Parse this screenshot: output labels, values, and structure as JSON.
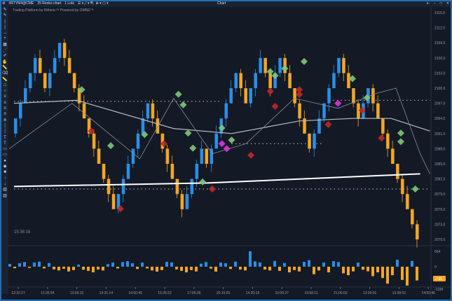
{
  "window": {
    "symbol": "#RTYM4@CME",
    "chart_type": "25 Renko chart",
    "lots": "1 Lots",
    "title": "Chart",
    "subtitle": "Trading Platform by Rithmic™  Powered by OMNE™",
    "win_controls": [
      "⇤",
      "–",
      "□",
      "✕"
    ]
  },
  "toolbar_icons": [
    "pencil",
    "pencil",
    "line",
    "line",
    "arrow",
    "plus",
    "grid",
    "dots",
    "brush",
    "hand",
    "ruler",
    "eraser",
    "ruler",
    "rect",
    "ellipse",
    "fib",
    "fib",
    "fib",
    "fib",
    "pitchfork",
    "dash",
    "dash",
    "text",
    "T",
    "shape",
    "shape",
    "circle",
    "diamond",
    "square",
    "up",
    "down",
    "bars",
    "bars"
  ],
  "clock": "15:36:16",
  "price_axis": {
    "labels": [
      "2115.0",
      "2112.0",
      "2109.0",
      "2106.0",
      "2103.0",
      "2100.0",
      "2097.0",
      "2094.0",
      "2091.0",
      "2088.0",
      "2085.0",
      "2082.0",
      "2079.0",
      "2076.0",
      "2073.0",
      "2070.0"
    ]
  },
  "volume_axis": {
    "labels": [
      "664",
      "0",
      "-1189"
    ],
    "last_label": "-731"
  },
  "time_axis": [
    "13:32:27",
    "13:35:54",
    "13:56:10",
    "14:31:14",
    "14:50:45",
    "15:26:22",
    "17:05:26",
    "20:16:03",
    "14:30:18",
    "15:09:27",
    "19:58:11",
    "21:00:00",
    "13:30:01",
    "13:58:02",
    "14:50:46"
  ],
  "colors": {
    "up": "#2b8ee6",
    "down": "#f5a623",
    "green": "#6fbf6a",
    "red": "#c0282b",
    "magenta": "#e033e0",
    "bg": "#131a26"
  },
  "chart_data": {
    "type": "renko",
    "brick": 3,
    "waypoints": [
      2089.7,
      2105.7,
      2099.4,
      2107.8,
      2076.5,
      2098,
      2077,
      2088,
      2084,
      2104.3,
      2097,
      2105,
      2100,
      2106,
      2089,
      2106,
      2093,
      2101,
      2069
    ],
    "ylim": [
      2068,
      2116
    ],
    "ma_slow": [
      [
        0,
        2080.5
      ],
      [
        40,
        2081.2
      ],
      [
        84,
        2083
      ]
    ],
    "ma_mid": [
      [
        0,
        2097
      ],
      [
        13,
        2097.6
      ],
      [
        33,
        2092
      ],
      [
        45,
        2091
      ],
      [
        59,
        2093.5
      ],
      [
        70,
        2094
      ],
      [
        78,
        2094
      ],
      [
        86,
        2091.5
      ]
    ],
    "ma_fast": [
      [
        -1,
        2088
      ],
      [
        12,
        2097
      ],
      [
        26,
        2086
      ],
      [
        33,
        2098
      ],
      [
        41,
        2087
      ],
      [
        48,
        2089
      ],
      [
        58,
        2098
      ],
      [
        67,
        2096
      ],
      [
        75,
        2099
      ],
      [
        79,
        2100
      ],
      [
        84,
        2087
      ],
      [
        86,
        2083
      ]
    ],
    "levels": [
      [
        0,
        43,
        2097.4
      ],
      [
        45,
        64,
        2089
      ],
      [
        66,
        86,
        2097.6
      ],
      [
        0,
        86,
        2080
      ]
    ],
    "markers": [
      [
        14,
        2099.7,
        "green"
      ],
      [
        20,
        2088.6,
        "green"
      ],
      [
        27,
        2090.8,
        "green"
      ],
      [
        34,
        2098.8,
        "green"
      ],
      [
        35,
        2096.7,
        "green"
      ],
      [
        36,
        2091.1,
        "green"
      ],
      [
        37,
        2088.1,
        "green"
      ],
      [
        39,
        2081.4,
        "green"
      ],
      [
        43,
        2092.1,
        "green"
      ],
      [
        45,
        2089.7,
        "green"
      ],
      [
        53,
        2103.3,
        "green"
      ],
      [
        54,
        2102.5,
        "green"
      ],
      [
        56,
        2103.9,
        "green"
      ],
      [
        60,
        2105.3,
        "green"
      ],
      [
        70,
        2101.9,
        "green"
      ],
      [
        73,
        2098.1,
        "green"
      ],
      [
        80,
        2091.1,
        "green"
      ],
      [
        80,
        2089.4,
        "green"
      ],
      [
        83,
        2080,
        "green"
      ],
      [
        16,
        2091.5,
        "red"
      ],
      [
        31,
        2089,
        "red"
      ],
      [
        41,
        2080,
        "red"
      ],
      [
        22,
        2076.1,
        "red"
      ],
      [
        49,
        2086.7,
        "red"
      ],
      [
        53,
        2099.4,
        "red"
      ],
      [
        54,
        2096.4,
        "red"
      ],
      [
        59,
        2099.7,
        "red"
      ],
      [
        59,
        2098.75,
        "red"
      ],
      [
        65,
        2092.8,
        "red"
      ],
      [
        76,
        2090.1,
        "red"
      ],
      [
        72,
        2095.6,
        "red"
      ],
      [
        43,
        2089,
        "magenta"
      ],
      [
        44,
        2088,
        "magenta"
      ],
      [
        67,
        2097,
        "magenta"
      ]
    ],
    "volume": [
      120,
      -80,
      150,
      200,
      -60,
      180,
      220,
      -90,
      160,
      -140,
      -200,
      -110,
      -250,
      -180,
      90,
      -160,
      -220,
      -300,
      -150,
      -200,
      110,
      180,
      -90,
      200,
      240,
      150,
      -120,
      180,
      -90,
      -200,
      -260,
      -180,
      210,
      180,
      -140,
      -220,
      -300,
      -180,
      -250,
      130,
      200,
      -100,
      -260,
      180,
      150,
      -120,
      220,
      -150,
      -200,
      664,
      230,
      180,
      -150,
      -200,
      250,
      -220,
      160,
      -300,
      -180,
      -250,
      210,
      280,
      -400,
      -200,
      180,
      -300,
      240,
      200,
      -350,
      -450,
      -250,
      180,
      -160,
      -240,
      -500,
      -300,
      -600,
      -900,
      -450,
      300,
      -700,
      -1000,
      250,
      -731
    ]
  }
}
